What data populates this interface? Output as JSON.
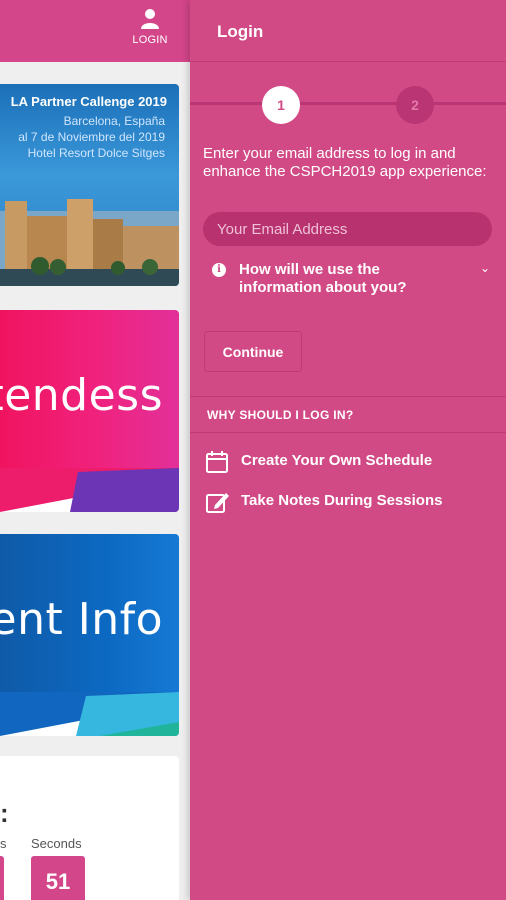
{
  "header": {
    "login_label": "LOGIN"
  },
  "banner": {
    "title": "LA Partner Callenge 2019",
    "line1": "Barcelona, España",
    "line2": "al 7 de Noviembre del 2019",
    "line3": "Hotel Resort Dolce Sitges"
  },
  "tiles": {
    "attendees": "ttendess",
    "event_info": "vent Info"
  },
  "countdown": {
    "colon": ":",
    "prev_label_fragment": "s",
    "seconds_label": "Seconds",
    "seconds_value": "51"
  },
  "drawer": {
    "title": "Login",
    "steps": [
      "1",
      "2"
    ],
    "intro": "Enter your email address to log in and enhance the CSPCH2019 app experience:",
    "email_placeholder": "Your Email Address",
    "info_question": "How will we use the information about you?",
    "continue_label": "Continue",
    "why_heading": "WHY SHOULD I LOG IN?",
    "benefits": [
      {
        "icon": "calendar-icon",
        "label": "Create Your Own Schedule"
      },
      {
        "icon": "edit-note-icon",
        "label": "Take Notes During Sessions"
      }
    ]
  },
  "colors": {
    "primary": "#d24a85",
    "primary_dark": "#b8326f",
    "attendees_tile": "#f0145f",
    "event_tile": "#0f5aa8"
  }
}
